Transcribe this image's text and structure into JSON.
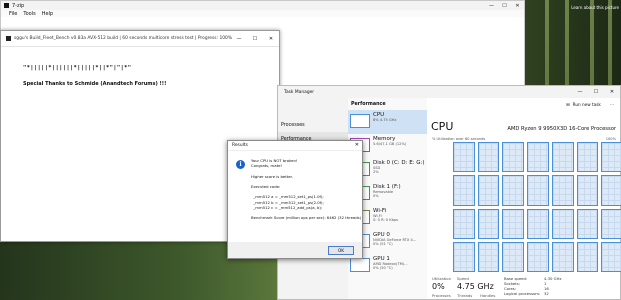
{
  "desktop_text": "Learn about this picture",
  "sevenzip": {
    "title": "7-zip",
    "menu": [
      "File",
      "Tools",
      "Help"
    ]
  },
  "console": {
    "title": "sggu's Build_Fleet_Bench v0.83a AVX-512 build | 60 seconds multicore stress test | Progress: 100%",
    "line1": "\"*|||||*||||||*|||||*||*\"|\"|*\"",
    "line2": "Special Thanks to Schmide (Anandtech Forums) !!!"
  },
  "taskmgr": {
    "title": "Task Manager",
    "nav": [
      "Processes",
      "Performance"
    ],
    "header": "Performance",
    "run_task": "Run new task",
    "items": [
      {
        "name": "CPU",
        "sub": "8% 4.75 GHz"
      },
      {
        "name": "Memory",
        "sub": "5.6/47.1 GB (12%)"
      },
      {
        "name": "Disk 0 (C: D: E: G:)",
        "sub": "SSD\n2%"
      },
      {
        "name": "Disk 1 (F:)",
        "sub": "Removable\n0%"
      },
      {
        "name": "Wi-Fi",
        "sub": "Wi-Fi\nS: 0 R: 0 Kbps"
      },
      {
        "name": "GPU 0",
        "sub": "NVIDIA GeForce RTX 4...\n0% (51 °C)"
      },
      {
        "name": "GPU 1",
        "sub": "AMD Radeon(TM)...\n0% (50 °C)"
      }
    ],
    "cpu_title": "CPU",
    "cpu_name": "AMD Ryzen 9 9950X3D 16-Core Processor",
    "util_label": "% Utilization over 60 seconds",
    "util_max": "100%",
    "utilization_label": "Utilization",
    "utilization": "0%",
    "speed_label": "Speed",
    "speed": "4.75 GHz",
    "bottom_labels": [
      "Processes",
      "Threads",
      "Handles"
    ],
    "specs": [
      {
        "k": "Base speed:",
        "v": "4.30 GHz"
      },
      {
        "k": "Sockets:",
        "v": "1"
      },
      {
        "k": "Cores:",
        "v": "16"
      },
      {
        "k": "Logical processors:",
        "v": "32"
      }
    ]
  },
  "dialog": {
    "title": "Results",
    "body": "Your CPU is NOT broken!\nCongrats, mate!\n\nHigher score is better.\n\nExecuted code:\n\n  _mm512 a = _mm512_set1_ps(1.0f);\n  _mm512 b = _mm512_set1_ps(2.0f);\n  _mm512 c = _mm512_add_ps(a, b);\n\nBenchmark Score (million ops per sec): 6462 (32 threads)",
    "ok": "OK"
  }
}
